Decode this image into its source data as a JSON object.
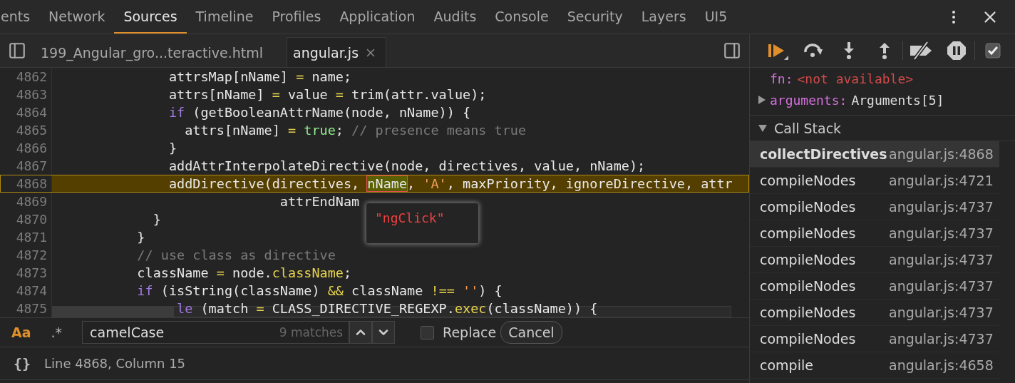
{
  "panel_tabs": [
    {
      "label": "ents",
      "selected": false
    },
    {
      "label": "Network",
      "selected": false
    },
    {
      "label": "Sources",
      "selected": true
    },
    {
      "label": "Timeline",
      "selected": false
    },
    {
      "label": "Profiles",
      "selected": false
    },
    {
      "label": "Application",
      "selected": false
    },
    {
      "label": "Audits",
      "selected": false
    },
    {
      "label": "Console",
      "selected": false
    },
    {
      "label": "Security",
      "selected": false
    },
    {
      "label": "Layers",
      "selected": false
    },
    {
      "label": "UI5",
      "selected": false
    }
  ],
  "file_tabs": [
    {
      "label": "199_Angular_gro...teractive.html",
      "selected": false,
      "closable": false
    },
    {
      "label": "angular.js",
      "selected": true,
      "closable": true
    }
  ],
  "code": [
    {
      "number": "4862",
      "current": false,
      "tokens": [
        {
          "kind": "plain",
          "text": "              attrsMap[nName] "
        },
        {
          "kind": "op",
          "text": "="
        },
        {
          "kind": "plain",
          "text": " name;"
        }
      ]
    },
    {
      "number": "4863",
      "current": false,
      "tokens": [
        {
          "kind": "plain",
          "text": "              attrs[nName] "
        },
        {
          "kind": "op",
          "text": "="
        },
        {
          "kind": "plain",
          "text": " value "
        },
        {
          "kind": "op",
          "text": "="
        },
        {
          "kind": "plain",
          "text": " trim(attr.value);"
        }
      ]
    },
    {
      "number": "4864",
      "current": false,
      "tokens": [
        {
          "kind": "keyword",
          "text": "              if"
        },
        {
          "kind": "plain",
          "text": " (getBooleanAttrName(node, nName)) {"
        }
      ]
    },
    {
      "number": "4865",
      "current": false,
      "tokens": [
        {
          "kind": "plain",
          "text": "                attrs[nName] "
        },
        {
          "kind": "op",
          "text": "= "
        },
        {
          "kind": "literal",
          "text": "true"
        },
        {
          "kind": "plain",
          "text": "; "
        },
        {
          "kind": "comment",
          "text": "// presence means true"
        }
      ]
    },
    {
      "number": "4866",
      "current": false,
      "tokens": [
        {
          "kind": "plain",
          "text": "              }"
        }
      ]
    },
    {
      "number": "4867",
      "current": false,
      "tokens": [
        {
          "kind": "plain",
          "text": "              addAttrInterpolateDirective(node, directives, value, nName);"
        }
      ]
    },
    {
      "number": "4868",
      "current": true,
      "tokens": [
        {
          "kind": "plain",
          "text": "              addDirective(directives, "
        },
        {
          "kind": "hovered",
          "text": "nName"
        },
        {
          "kind": "plain",
          "text": ", "
        },
        {
          "kind": "string",
          "text": "'A'"
        },
        {
          "kind": "plain",
          "text": ", maxPriority, ignoreDirective, attr"
        }
      ]
    },
    {
      "number": "4869",
      "current": false,
      "tokens": [
        {
          "kind": "plain",
          "text": "                            attrEndNam"
        }
      ]
    },
    {
      "number": "4870",
      "current": false,
      "tokens": [
        {
          "kind": "plain",
          "text": "            }"
        }
      ]
    },
    {
      "number": "4871",
      "current": false,
      "tokens": [
        {
          "kind": "plain",
          "text": "          }"
        }
      ]
    },
    {
      "number": "4872",
      "current": false,
      "tokens": [
        {
          "kind": "comment",
          "text": "          // use class as directive"
        }
      ]
    },
    {
      "number": "4873",
      "current": false,
      "tokens": [
        {
          "kind": "plain",
          "text": "          className "
        },
        {
          "kind": "op",
          "text": "="
        },
        {
          "kind": "plain",
          "text": " node."
        },
        {
          "kind": "prop",
          "text": "className"
        },
        {
          "kind": "plain",
          "text": ";"
        }
      ]
    },
    {
      "number": "4874",
      "current": false,
      "tokens": [
        {
          "kind": "keyword",
          "text": "          if"
        },
        {
          "kind": "plain",
          "text": " (isString(className) "
        },
        {
          "kind": "op",
          "text": "&&"
        },
        {
          "kind": "plain",
          "text": " className "
        },
        {
          "kind": "op",
          "text": "!== "
        },
        {
          "kind": "string",
          "text": "''"
        },
        {
          "kind": "plain",
          "text": ") {"
        }
      ]
    },
    {
      "number": "4875",
      "current": false,
      "tokens": [
        {
          "kind": "keyword",
          "text": "               le"
        },
        {
          "kind": "plain",
          "text": " (match "
        },
        {
          "kind": "op",
          "text": "="
        },
        {
          "kind": "plain",
          "text": " CLASS_DIRECTIVE_REGEXP."
        },
        {
          "kind": "prop",
          "text": "exec"
        },
        {
          "kind": "plain",
          "text": "(className)) {"
        }
      ]
    }
  ],
  "hover_value": "\"ngClick\"",
  "find_bar": {
    "case_toggle": "Aa",
    "case_on": true,
    "regex_toggle": ".*",
    "regex_on": false,
    "value": "camelCase",
    "matches": "9 matches",
    "replace_label": "Replace",
    "replace_checked": false,
    "cancel": "Cancel"
  },
  "status_bar": {
    "braces": "{}",
    "position": "Line 4868, Column 15"
  },
  "scope": [
    {
      "name": "fn:",
      "value": "<not available>",
      "expandable": false
    },
    {
      "name": "arguments:",
      "value": "Arguments[5]",
      "expandable": true
    }
  ],
  "call_stack": {
    "title": "Call Stack",
    "expanded": true,
    "frames": [
      {
        "function": "collectDirectives",
        "location": "angular.js:4868",
        "selected": true
      },
      {
        "function": "compileNodes",
        "location": "angular.js:4721",
        "selected": false
      },
      {
        "function": "compileNodes",
        "location": "angular.js:4737",
        "selected": false
      },
      {
        "function": "compileNodes",
        "location": "angular.js:4737",
        "selected": false
      },
      {
        "function": "compileNodes",
        "location": "angular.js:4737",
        "selected": false
      },
      {
        "function": "compileNodes",
        "location": "angular.js:4737",
        "selected": false
      },
      {
        "function": "compileNodes",
        "location": "angular.js:4737",
        "selected": false
      },
      {
        "function": "compileNodes",
        "location": "angular.js:4737",
        "selected": false
      },
      {
        "function": "compile",
        "location": "angular.js:4658",
        "selected": false
      }
    ]
  },
  "pause_on_caught": true
}
